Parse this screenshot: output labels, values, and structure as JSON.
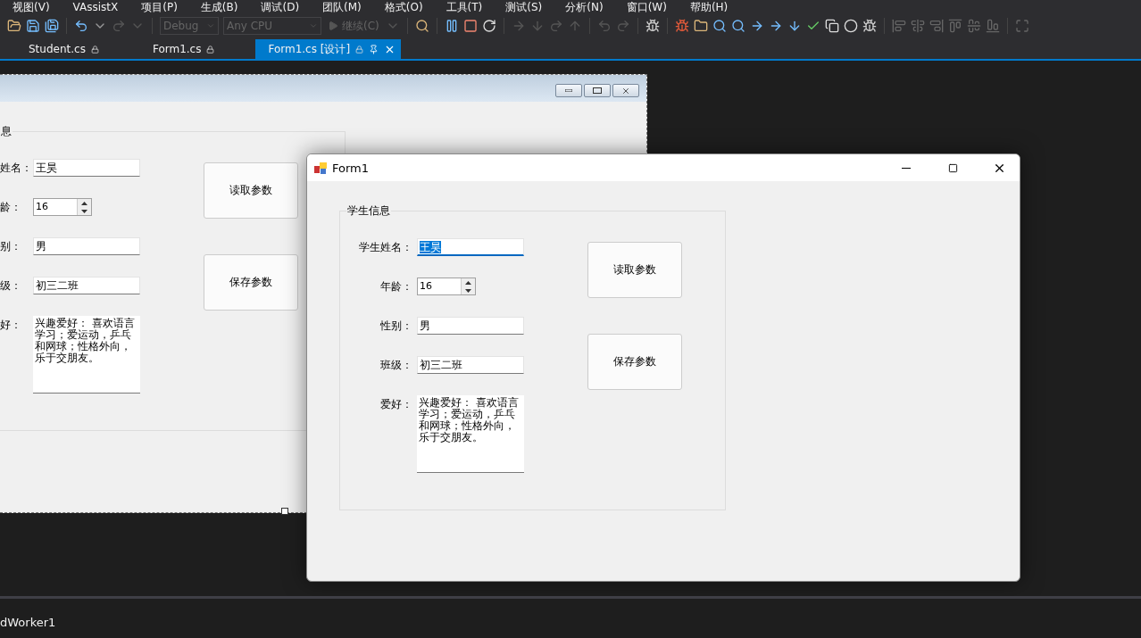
{
  "menu": [
    "视图(V)",
    "VAssistX",
    "项目(P)",
    "生成(B)",
    "调试(D)",
    "团队(M)",
    "格式(O)",
    "工具(T)",
    "测试(S)",
    "分析(N)",
    "窗口(W)",
    "帮助(H)"
  ],
  "toolbar": {
    "configuration": "Debug",
    "platform": "Any CPU",
    "continue": "继续(C)"
  },
  "tabs": [
    {
      "label": "Student.cs",
      "selected": false
    },
    {
      "label": "Form1.cs",
      "selected": false
    },
    {
      "label": "Form1.cs [设计]",
      "selected": true
    }
  ],
  "designer_form": {
    "group_title": "息",
    "fields": [
      {
        "kind": "text",
        "label": "姓名：",
        "value": "王昊",
        "focused": false
      },
      {
        "kind": "spin",
        "label": "龄：",
        "value": "16",
        "focused": false
      },
      {
        "kind": "text",
        "label": "别：",
        "value": "男",
        "focused": false
      },
      {
        "kind": "text",
        "label": "级：",
        "value": "初三二班",
        "focused": false
      },
      {
        "kind": "multiline",
        "label": "好：",
        "value": "兴趣爱好：  喜欢语言学习；爱运动，乒乓和网球；性格外向，乐于交朋友。",
        "focused": false
      }
    ],
    "buttons": [
      "读取参数",
      "保存参数"
    ]
  },
  "running_form": {
    "title": "Form1",
    "group_title": "学生信息",
    "fields": [
      {
        "kind": "text",
        "label": "学生姓名：",
        "value": "王昊",
        "focused": true
      },
      {
        "kind": "spin",
        "label": "年龄：",
        "value": "16",
        "focused": false
      },
      {
        "kind": "text",
        "label": "性别：",
        "value": "男",
        "focused": false
      },
      {
        "kind": "text",
        "label": "班级：",
        "value": "初三二班",
        "focused": false
      },
      {
        "kind": "multiline",
        "label": "爱好：",
        "value": "兴趣爱好：  喜欢语言学习；爱运动，乒乓和网球；性格外向，乐于交朋友。",
        "focused": false
      }
    ],
    "buttons": [
      "读取参数",
      "保存参数"
    ]
  },
  "component_tray": {
    "item": "dWorker1"
  }
}
